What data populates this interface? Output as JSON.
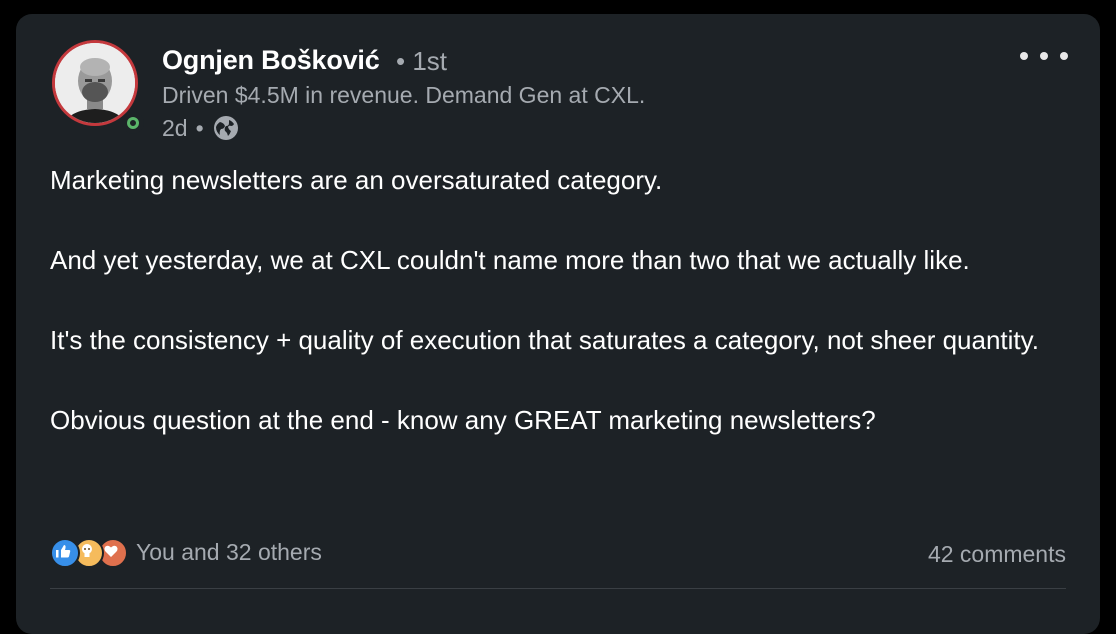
{
  "author": {
    "name": "Ognjen Bošković",
    "degree_sep": "•",
    "degree": "1st",
    "headline": "Driven $4.5M in revenue. Demand Gen at CXL.",
    "posted_ago": "2d",
    "meta_sep": "•",
    "visibility_icon": "globe-icon",
    "online_status": "online"
  },
  "post": {
    "paragraphs": [
      "Marketing newsletters are an oversaturated category.",
      "And yet yesterday, we at CXL couldn't name more than two that we actually like.",
      "It's the consistency + quality of execution that saturates a category, not sheer quantity.",
      "Obvious question at the end - know any GREAT marketing newsletters?"
    ]
  },
  "social": {
    "reaction_types": [
      "like-icon",
      "insightful-icon",
      "love-icon"
    ],
    "reactions_text": "You and 32 others",
    "comments_text": "42 comments"
  },
  "colors": {
    "background": "#000000",
    "card": "#1d2226",
    "text_primary": "#ffffff",
    "text_secondary": "#a5aab0",
    "avatar_ring": "#c4393d",
    "online": "#5bb56a",
    "like": "#378fe9",
    "insightful": "#f5bb5c",
    "love": "#df704d"
  }
}
